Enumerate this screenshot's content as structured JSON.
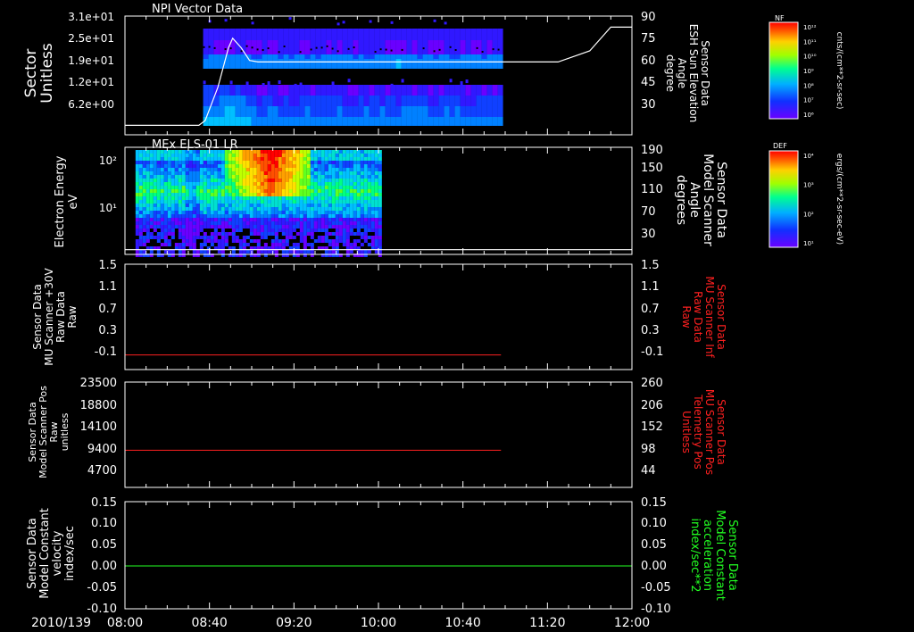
{
  "date_label": "2010/139",
  "time_ticks": [
    "08:00",
    "08:40",
    "09:20",
    "10:00",
    "10:40",
    "11:20",
    "12:00"
  ],
  "colors": {
    "background": "#000000",
    "axis": "#ffffff",
    "red_line": "#ff2020",
    "green_line": "#22ff22",
    "right_label_red": "#ff2020",
    "right_label_green": "#22ff22"
  },
  "panels": {
    "p1": {
      "title": "NPI Vector Data",
      "left_label": [
        "Sector",
        "Unitless"
      ],
      "left_ticks": [
        "3.1e+01",
        "2.5e+01",
        "1.9e+01",
        "1.2e+01",
        "6.2e+00"
      ],
      "right_label": [
        "Sensor Data",
        "ESH Sun Elevation",
        "Angle",
        "degree"
      ],
      "right_ticks": [
        "90",
        "75",
        "60",
        "45",
        "30"
      ],
      "colorbar": {
        "title": "NF",
        "units": "cnts/(cm**2-sr-sec)",
        "ticks": [
          "10¹²",
          "10¹¹",
          "10¹⁰",
          "10⁹",
          "10⁸",
          "10⁷",
          "10⁶"
        ]
      }
    },
    "p2": {
      "title": "MEx ELS-01 LR",
      "left_label": [
        "Electron Energy",
        "eV"
      ],
      "left_ticks": [
        "10²",
        "10¹"
      ],
      "right_label": [
        "Sensor Data",
        "Model Scanner",
        "Angle",
        "degrees"
      ],
      "right_ticks": [
        "190",
        "150",
        "110",
        "70",
        "30"
      ],
      "colorbar": {
        "title": "DEF",
        "units": "ergs/(cm**2-sr-sec-eV)",
        "ticks": [
          "10⁴",
          "10³",
          "10²",
          "10¹"
        ]
      }
    },
    "p3": {
      "left_label": [
        "Sensor Data",
        "MU Scanner +30V",
        "Raw Data",
        "Raw"
      ],
      "left_ticks": [
        "1.5",
        "1.1",
        "0.7",
        "0.3",
        "-0.1"
      ],
      "right_label": [
        "Sensor Data",
        "MU Scanner Inf",
        "Raw Data",
        "Raw"
      ],
      "right_ticks": [
        "1.5",
        "1.1",
        "0.7",
        "0.3",
        "-0.1"
      ]
    },
    "p4": {
      "left_label": [
        "Sensor Data",
        "Model Scanner Pos",
        "Raw",
        "unitless"
      ],
      "left_ticks": [
        "23500",
        "18800",
        "14100",
        "9400",
        "4700"
      ],
      "right_label": [
        "Sensor Data",
        "MU Scanner Pos",
        "Telemetry Pos",
        "Unitless"
      ],
      "right_ticks": [
        "260",
        "206",
        "152",
        "98",
        "44"
      ]
    },
    "p5": {
      "left_label": [
        "Sensor Data",
        "Model Constant",
        "velocity",
        "index/sec"
      ],
      "left_ticks": [
        "0.15",
        "0.10",
        "0.05",
        "0.00",
        "-0.05",
        "-0.10"
      ],
      "right_label": [
        "Sensor Data",
        "Model Constant",
        "acceleration",
        "index/sec**2"
      ],
      "right_ticks": [
        "0.15",
        "0.10",
        "0.05",
        "0.00",
        "-0.05",
        "-0.10"
      ]
    }
  },
  "chart_data": [
    {
      "type": "heatmap",
      "title": "NPI Vector Data",
      "ylabel": "Sector Unitless",
      "y2label": "Sensor Data ESH Sun Elevation Angle degree",
      "x": [
        "08:00",
        "12:00"
      ],
      "data_coverage": [
        "08:37",
        "10:57"
      ],
      "overlay_line": {
        "name": "ESH Sun Elevation",
        "x": [
          "08:00",
          "08:35",
          "08:38",
          "08:44",
          "08:49",
          "08:51",
          "08:55",
          "08:59",
          "09:03",
          "11:20",
          "11:25",
          "11:40",
          "11:50",
          "12:00"
        ],
        "y": [
          21,
          21,
          24,
          45,
          70,
          76,
          70,
          62,
          61,
          61,
          61,
          68,
          83,
          83
        ]
      },
      "y2lim": [
        15,
        90
      ]
    },
    {
      "type": "heatmap",
      "title": "MEx ELS-01 LR",
      "ylabel": "Electron Energy eV",
      "y2label": "Sensor Data Model Scanner Angle degrees",
      "x": [
        "08:00",
        "12:00"
      ],
      "data_coverage": [
        "08:05",
        "10:00"
      ],
      "yscale": "log",
      "overlay_line": {
        "name": "Model Scanner Angle",
        "x": [
          "08:00",
          "12:00"
        ],
        "y": [
          18,
          18
        ]
      },
      "y2lim": [
        10,
        190
      ]
    },
    {
      "type": "line",
      "ylabel": "Sensor Data MU Scanner +30V Raw Data Raw",
      "y2label": "Sensor Data MU Scanner Inf Raw Data Raw",
      "series": [
        {
          "x": [
            "08:00",
            "10:58"
          ],
          "y": [
            -0.05,
            -0.05
          ],
          "color": "#ff2020"
        }
      ],
      "ylim": [
        -0.3,
        1.5
      ]
    },
    {
      "type": "line",
      "ylabel": "Sensor Data Model Scanner Pos Raw unitless",
      "y2label": "Sensor Data MU Scanner Pos Telemetry Pos Unitless",
      "series": [
        {
          "x": [
            "08:00",
            "10:58"
          ],
          "y": [
            8300,
            8300
          ],
          "color": "#ff2020"
        }
      ],
      "ylim": [
        0,
        23500
      ]
    },
    {
      "type": "line",
      "ylabel": "Sensor Data Model Constant velocity index/sec",
      "y2label": "Sensor Data Model Constant acceleration index/sec**2",
      "series": [
        {
          "x": [
            "08:00",
            "12:00"
          ],
          "y": [
            0.0,
            0.0
          ],
          "color": "#22ff22"
        }
      ],
      "ylim": [
        -0.1,
        0.15
      ]
    }
  ]
}
